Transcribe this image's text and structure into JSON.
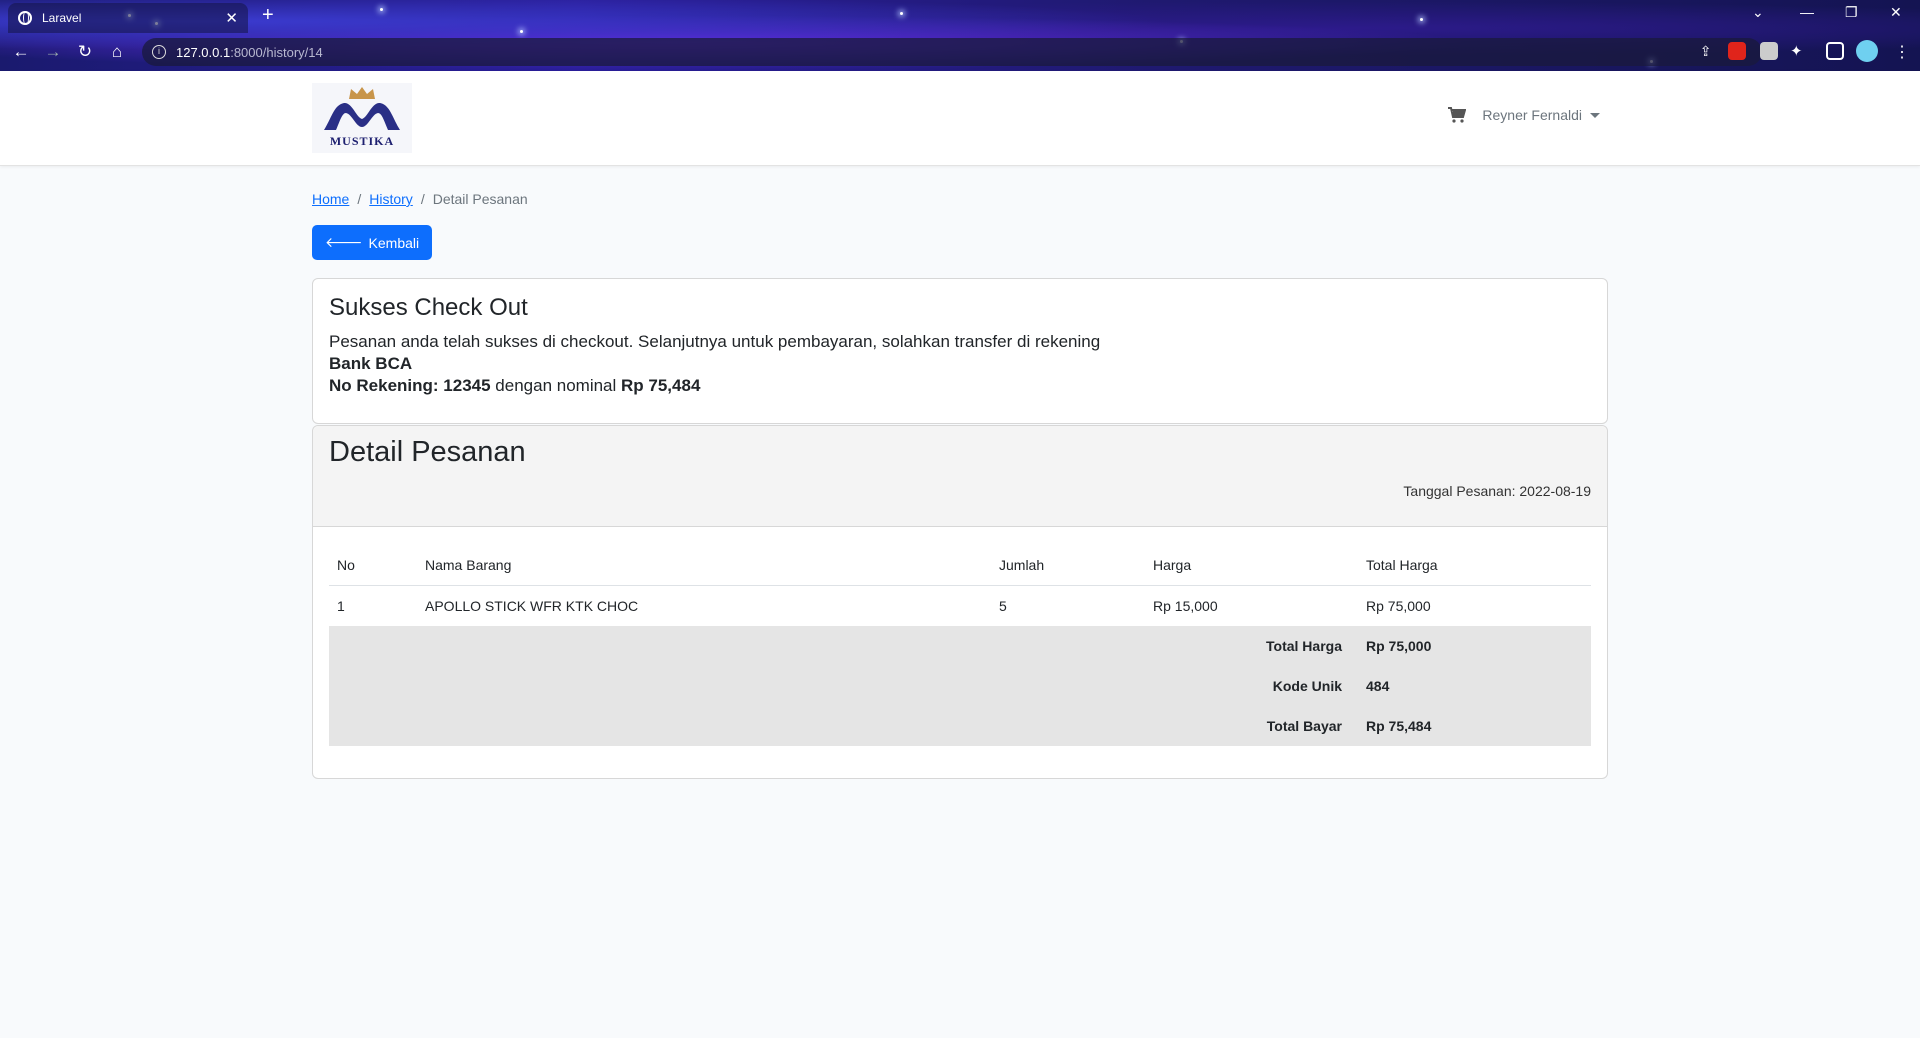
{
  "browser": {
    "tab_title": "Laravel",
    "url_host": "127.0.0.1",
    "url_path": ":8000/history/14"
  },
  "navbar": {
    "logo_text": "MUSTIKA",
    "user_name": "Reyner Fernaldi"
  },
  "breadcrumb": {
    "home": "Home",
    "history": "History",
    "current": "Detail Pesanan"
  },
  "back_button": "Kembali",
  "success": {
    "title": "Sukses Check Out",
    "message": "Pesanan anda telah sukses di checkout. Selanjutnya untuk pembayaran, solahkan transfer di rekening",
    "bank": "Bank BCA",
    "account_label": "No Rekening: 12345",
    "middle_text": "dengan nominal",
    "amount": "Rp 75,484"
  },
  "detail": {
    "title": "Detail Pesanan",
    "order_date": "Tanggal Pesanan: 2022-08-19",
    "columns": [
      "No",
      "Nama Barang",
      "Jumlah",
      "Harga",
      "Total Harga"
    ],
    "rows": [
      [
        "1",
        "APOLLO STICK WFR KTK CHOC",
        "5",
        "Rp 15,000",
        "Rp 75,000"
      ]
    ],
    "summary": [
      {
        "label": "Total Harga",
        "value": "Rp 75,000"
      },
      {
        "label": "Kode Unik",
        "value": "484"
      },
      {
        "label": "Total Bayar",
        "value": "Rp 75,484"
      }
    ]
  }
}
